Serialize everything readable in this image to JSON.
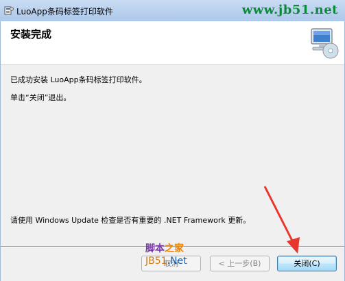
{
  "window": {
    "title": "LuoApp条码标签打印软件",
    "watermark": "www.jb51.net"
  },
  "header": {
    "title": "安装完成",
    "graphic_icon": "setup-computer-cd-icon"
  },
  "body": {
    "line1": "已成功安装 LuoApp条码标签打印软件。",
    "line2": "单击“关闭”退出。",
    "line3": "请使用 Windows Update 检查是否有重要的 .NET Framework 更新。"
  },
  "buttons": {
    "cancel": "取消",
    "back": "< 上一步(B)",
    "close": "关闭(C)"
  },
  "overlay": {
    "logo_line1a": "脚本",
    "logo_line1b": "之家",
    "logo_line2a": "JB51",
    "logo_line2b": ".Net",
    "arrow_color": "#e8362d"
  }
}
